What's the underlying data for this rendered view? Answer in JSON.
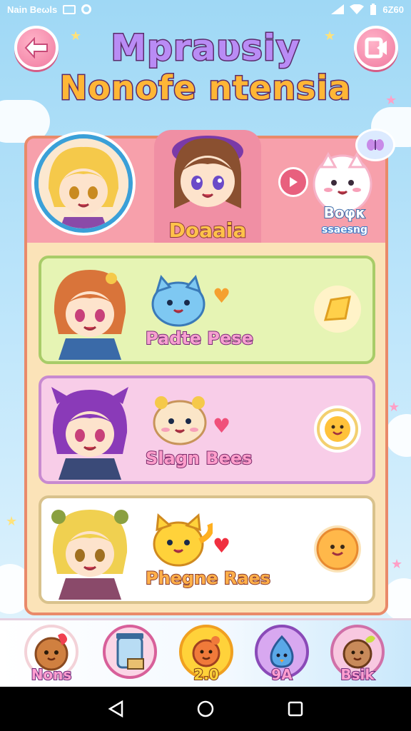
{
  "status_bar": {
    "left_text": "Nain Beωls",
    "right_text": "6Z60"
  },
  "title": {
    "line1": "Mpraυsiy",
    "line2": "Nonofe ntensia"
  },
  "hero": {
    "name": "Doaaia",
    "pet_name": "Boφκ",
    "pet_subtitle": "ssaesng"
  },
  "cards": [
    {
      "title": "Padte Pese",
      "theme": "green"
    },
    {
      "title": "Slagn Bees",
      "theme": "pink"
    },
    {
      "title": "Phegne Raes",
      "theme": "white"
    }
  ],
  "bottom_nav": [
    {
      "label": "Nons",
      "icon": "cookie-pet-icon"
    },
    {
      "label": "",
      "icon": "jar-icon"
    },
    {
      "label": "2.0",
      "icon": "fox-pet-icon"
    },
    {
      "label": "9A",
      "icon": "blue-bird-icon"
    },
    {
      "label": "Bsik",
      "icon": "bear-pet-icon"
    }
  ],
  "colors": {
    "accent_pink": "#f07aa0",
    "panel": "#f7b08a",
    "card_green": "#e6f4b4",
    "card_pink": "#f8cde8",
    "card_white": "#ffffff"
  }
}
